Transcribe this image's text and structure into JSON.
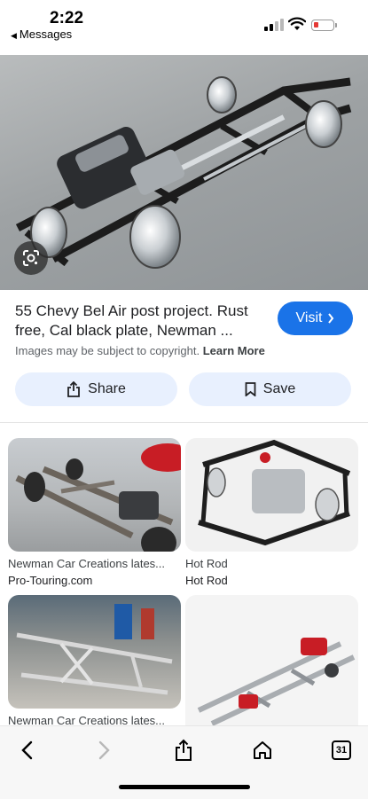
{
  "status_bar": {
    "time": "2:22",
    "back_app": "Messages"
  },
  "result": {
    "title": "55 Chevy Bel Air post project. Rust free, Cal black plate, Newman ...",
    "visit_label": "Visit",
    "copyright_text": "Images may be subject to copyright.",
    "learn_more": "Learn More",
    "share_label": "Share",
    "save_label": "Save"
  },
  "related": [
    {
      "title": "Newman Car Creations lates...",
      "source": "Pro-Touring.com"
    },
    {
      "title": "Hot Rod",
      "source": "Hot Rod"
    },
    {
      "title": "Newman Car Creations lates...",
      "source": ""
    },
    {
      "title": "",
      "source": ""
    }
  ],
  "toolbar": {
    "tabs_count": "31"
  },
  "colors": {
    "accent": "#1a73e8",
    "pill_bg": "#e8f0fe",
    "battery_low": "#e53935"
  }
}
